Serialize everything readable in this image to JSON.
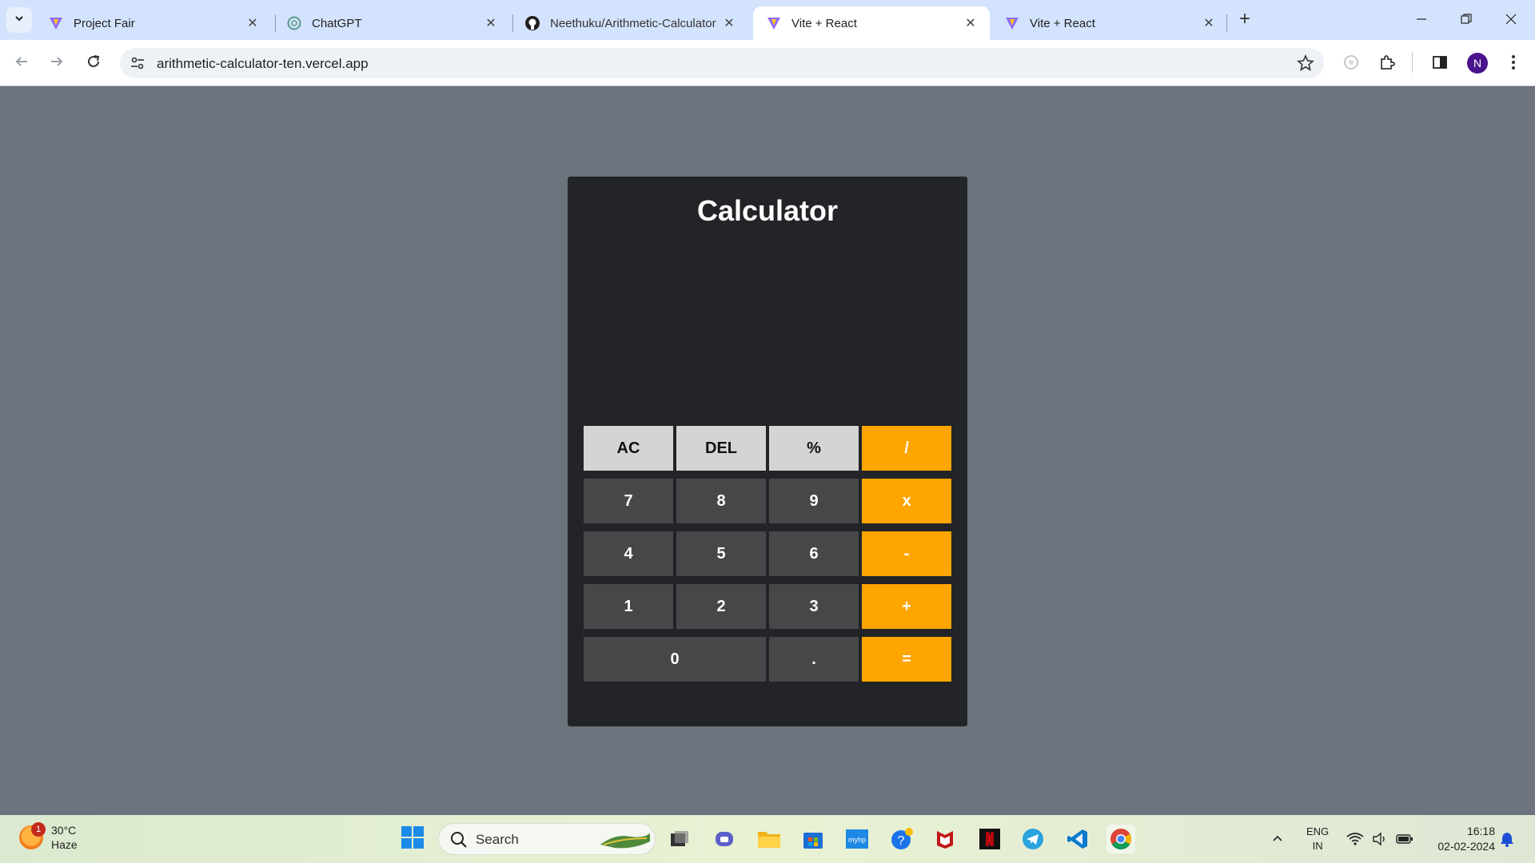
{
  "browser": {
    "tabs": [
      {
        "title": "Project Fair",
        "icon": "vite-icon"
      },
      {
        "title": "ChatGPT",
        "icon": "chatgpt-icon"
      },
      {
        "title": "Neethuku/Arithmetic-Calculator",
        "icon": "github-icon"
      },
      {
        "title": "Vite + React",
        "icon": "vite-icon",
        "active": true
      },
      {
        "title": "Vite + React",
        "icon": "vite-icon"
      }
    ],
    "url": "arithmetic-calculator-ten.vercel.app",
    "profile_initial": "N"
  },
  "calculator": {
    "title": "Calculator",
    "display": "",
    "keys": [
      "AC",
      "DEL",
      "%",
      "/",
      "7",
      "8",
      "9",
      "x",
      "4",
      "5",
      "6",
      "-",
      "1",
      "2",
      "3",
      "+",
      "0",
      ".",
      "="
    ],
    "colors": {
      "panel": "#222427",
      "function_key": "#d4d4d2",
      "number_key": "#474749",
      "operator_key": "#ffa500",
      "page_bg": "#6c737d"
    }
  },
  "taskbar": {
    "weather": {
      "temp": "30°C",
      "condition": "Haze",
      "badge": "1"
    },
    "search_label": "Search",
    "language": {
      "line1": "ENG",
      "line2": "IN"
    },
    "time": "16:18",
    "date": "02-02-2024"
  }
}
